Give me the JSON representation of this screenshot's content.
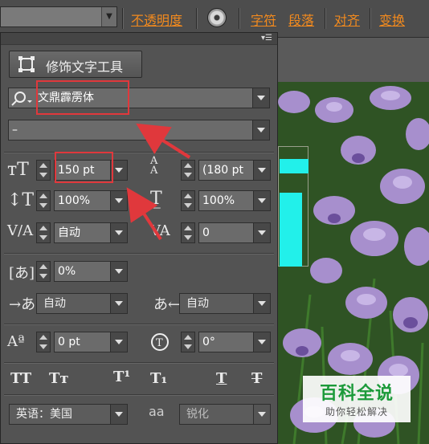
{
  "topbar": {
    "opacity_label": "不透明度",
    "character_label": "字符",
    "paragraph_label": "段落",
    "align_label": "对齐",
    "transform_label": "变换"
  },
  "panel": {
    "warp_button_label": "修饰文字工具",
    "font_family": "文鼎霹雳体",
    "font_style": "–",
    "font_size": "150 pt",
    "leading": "(180 pt",
    "vertical_scale": "100%",
    "horizontal_scale": "100%",
    "kerning": "自动",
    "tracking": "0",
    "tsume": "0%",
    "aki_left": "自动",
    "aki_right": "自动",
    "baseline_shift": "0 pt",
    "rotation": "0°",
    "language": "英语：美国",
    "antialias": "锐化",
    "antialias_icon": "aa"
  },
  "watermark": {
    "title": "百科全说",
    "subtitle": "助你轻松解决"
  },
  "colors": {
    "accent_link": "#f28a1e",
    "highlight_box": "#e0383c",
    "text_fill_preview": "#22f0ea"
  }
}
